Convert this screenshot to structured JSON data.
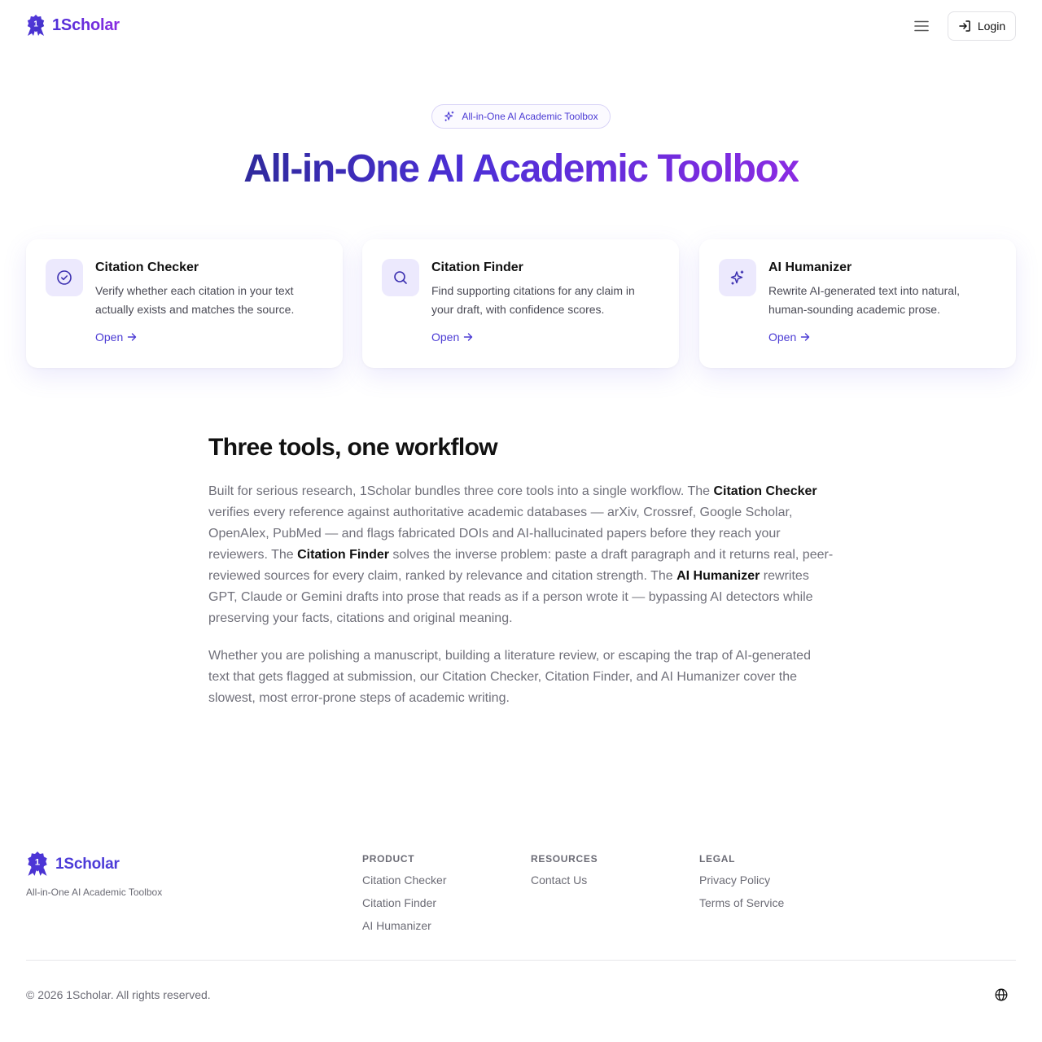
{
  "header": {
    "brand": "1Scholar",
    "logo_glyph": "1",
    "menu_icon": "hamburger-menu-icon",
    "login_label": "Login",
    "login_icon": "login-arrow-icon"
  },
  "hero": {
    "pill_label": "All-in-One AI Academic Toolbox",
    "pill_icon": "sparkles-icon",
    "title": "All-in-One AI Academic Toolbox"
  },
  "cards": [
    {
      "title": "Citation Checker",
      "description": "Verify whether each citation in your text actually exists and matches the source.",
      "link": "Open",
      "icon": "check-circle-icon"
    },
    {
      "title": "Citation Finder",
      "description": "Find supporting citations for any claim in your draft, with confidence scores.",
      "link": "Open",
      "icon": "search-icon"
    },
    {
      "title": "AI Humanizer",
      "description": "Rewrite AI-generated text into natural, human-sounding academic prose.",
      "link": "Open",
      "icon": "sparkles-icon"
    }
  ],
  "article": {
    "title": "Three tools, one workflow",
    "p1": {
      "a": "Built for serious research, 1Scholar bundles three core tools into a single workflow. The ",
      "b1": "Citation Checker",
      "c": " verifies every reference against authoritative academic databases — arXiv, Crossref, Google Scholar, OpenAlex, PubMed — and flags fabricated DOIs and AI-hallucinated papers before they reach your reviewers. The ",
      "b2": "Citation Finder",
      "d": " solves the inverse problem: paste a draft paragraph and it returns real, peer-reviewed sources for every claim, ranked by relevance and citation strength. The ",
      "b3": "AI Humanizer",
      "e": " rewrites GPT, Claude or Gemini drafts into prose that reads as if a person wrote it — bypassing AI detectors while preserving your facts, citations and original meaning."
    },
    "p2": "Whether you are polishing a manuscript, building a literature review, or escaping the trap of AI-generated text that gets flagged at submission, our Citation Checker, Citation Finder, and AI Humanizer cover the slowest, most error-prone steps of academic writing."
  },
  "footer": {
    "brand": "1Scholar",
    "tagline": "All-in-One AI Academic Toolbox",
    "columns": [
      {
        "heading": "PRODUCT",
        "links": [
          "Citation Checker",
          "Citation Finder",
          "AI Humanizer"
        ]
      },
      {
        "heading": "RESOURCES",
        "links": [
          "Contact Us"
        ]
      },
      {
        "heading": "LEGAL",
        "links": [
          "Privacy Policy",
          "Terms of Service"
        ]
      }
    ],
    "copyright": "© 2026 1Scholar. All rights reserved.",
    "language_icon": "globe-icon"
  },
  "colors": {
    "accent": "#4b3bd4",
    "accent_purple": "#8a2be2",
    "icon_bg": "#ece9fd",
    "muted_text": "#70707a"
  }
}
